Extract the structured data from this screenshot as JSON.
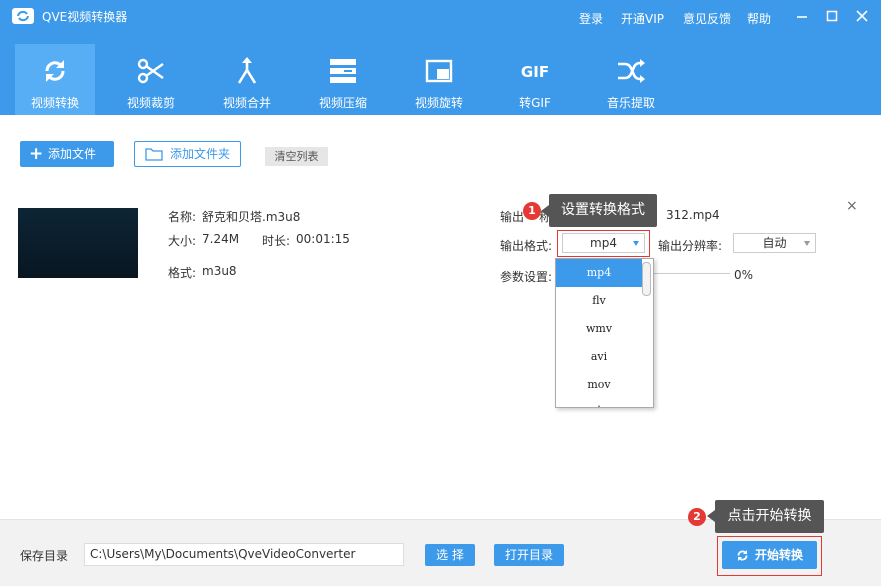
{
  "app": {
    "title": "QVE视频转换器"
  },
  "top_links": {
    "login": "登录",
    "vip": "开通VIP",
    "feedback": "意见反馈",
    "help": "帮助"
  },
  "tabs": [
    {
      "label": "视频转换",
      "icon": "refresh-icon",
      "active": true
    },
    {
      "label": "视频裁剪",
      "icon": "scissors-icon"
    },
    {
      "label": "视频合并",
      "icon": "merge-icon"
    },
    {
      "label": "视频压缩",
      "icon": "compress-icon"
    },
    {
      "label": "视频旋转",
      "icon": "rotate-icon"
    },
    {
      "label": "转GIF",
      "icon": "gif-icon",
      "icon_text": "GIF"
    },
    {
      "label": "音乐提取",
      "icon": "shuffle-icon"
    }
  ],
  "toolbar": {
    "add_file": "添加文件",
    "add_folder": "添加文件夹",
    "clear_list": "清空列表"
  },
  "file": {
    "name_label": "名称:",
    "name": "舒克和贝塔.m3u8",
    "size_label": "大小:",
    "size": "7.24M",
    "duration_label": "时长:",
    "duration": "00:01:15",
    "format_label": "格式:",
    "format": "m3u8"
  },
  "output": {
    "name_label_left": "输出",
    "name_label_right": "称",
    "name_value": "312.mp4",
    "format_label": "输出格式:",
    "format_value": "mp4",
    "resolution_label": "输出分辨率:",
    "resolution_value": "自动",
    "params_label": "参数设置:",
    "progress_text": "0%",
    "progress": 0
  },
  "dropdown": {
    "options": [
      "mp4",
      "flv",
      "wmv",
      "avi",
      "mov"
    ],
    "selected": "mp4"
  },
  "tips": {
    "tip1_num": "1",
    "tip1": "设置转换格式",
    "tip2_num": "2",
    "tip2": "点击开始转换"
  },
  "footer": {
    "save_dir_label": "保存目录",
    "path": "C:\\Users\\My\\Documents\\QveVideoConverter",
    "choose": "选 择",
    "open_dir": "打开目录",
    "start": "开始转换"
  },
  "colors": {
    "primary": "#3d9aea",
    "active_tab": "#57aef4",
    "tooltip": "#555555",
    "highlight_red": "#e53935"
  }
}
